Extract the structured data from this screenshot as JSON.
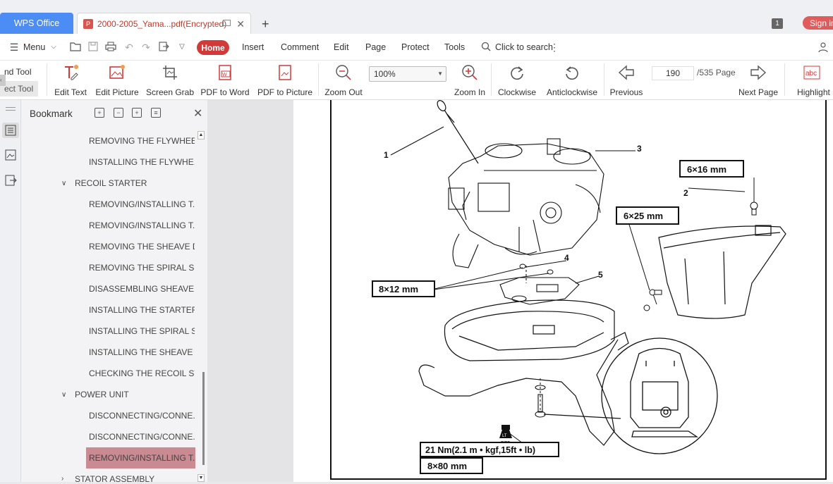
{
  "titlebar": {
    "wps_tab": "WPS Office",
    "doc_tab": "2000-2005_Yama...pdf(Encrypted)",
    "window_badge": "1",
    "signin": "Sign in"
  },
  "menubar": {
    "menu": "Menu",
    "tabs": [
      "Home",
      "Insert",
      "Comment",
      "Edit",
      "Page",
      "Protect",
      "Tools"
    ],
    "search": "Click to search"
  },
  "ribbon": {
    "hand_tool": "nd Tool",
    "select_tool": "ect Tool",
    "edit_text": "Edit Text",
    "edit_picture": "Edit Picture",
    "screen_grab": "Screen Grab",
    "pdf_to_word": "PDF to Word",
    "pdf_to_picture": "PDF to Picture",
    "zoom_out": "Zoom Out",
    "zoom_value": "100%",
    "zoom_in": "Zoom In",
    "clockwise": "Clockwise",
    "anticlockwise": "Anticlockwise",
    "previous": "Previous",
    "page_current": "190",
    "page_total": "/535 Page",
    "next_page": "Next Page",
    "highlight": "Highlight",
    "highlight_icon_text": "abc"
  },
  "bookmark": {
    "title": "Bookmark",
    "items": [
      {
        "label": "REMOVING THE FLYWHEE...",
        "level": 2
      },
      {
        "label": "INSTALLING THE FLYWHE...",
        "level": 2
      },
      {
        "label": "RECOIL STARTER",
        "level": 1,
        "expanded": true
      },
      {
        "label": "REMOVING/INSTALLING T...",
        "level": 2
      },
      {
        "label": "REMOVING/INSTALLING T...",
        "level": 2
      },
      {
        "label": "REMOVING THE SHEAVE D...",
        "level": 2
      },
      {
        "label": "REMOVING THE SPIRAL SP...",
        "level": 2
      },
      {
        "label": "DISASSEMBLING SHEAVE ...",
        "level": 2
      },
      {
        "label": "INSTALLING THE STARTER...",
        "level": 2
      },
      {
        "label": "INSTALLING THE SPIRAL S...",
        "level": 2
      },
      {
        "label": "INSTALLING THE SHEAVE ...",
        "level": 2
      },
      {
        "label": "CHECKING THE RECOIL ST...",
        "level": 2
      },
      {
        "label": "POWER UNIT",
        "level": 1,
        "expanded": true
      },
      {
        "label": "DISCONNECTING/CONNE...",
        "level": 2
      },
      {
        "label": "DISCONNECTING/CONNE...",
        "level": 2
      },
      {
        "label": "REMOVING/INSTALLING T...",
        "level": 2,
        "selected": true
      },
      {
        "label": "STATOR ASSEMBLY",
        "level": 1,
        "expanded": false
      }
    ]
  },
  "diagram": {
    "callouts": [
      "1",
      "2",
      "3",
      "4",
      "5"
    ],
    "bolt_6x16": "6×16 mm",
    "bolt_6x25": "6×25 mm",
    "bolt_8x12": "8×12 mm",
    "torque": "21 Nm(2.1 m • kgf,15ft • lb)",
    "bolt_8x80": "8×80 mm",
    "locktite_label": "LT",
    "locktite_num": "572"
  },
  "colors": {
    "accent": "#d23a3a",
    "wps_blue": "#4b8cf5",
    "bookmark_selected": "#c98a92"
  }
}
